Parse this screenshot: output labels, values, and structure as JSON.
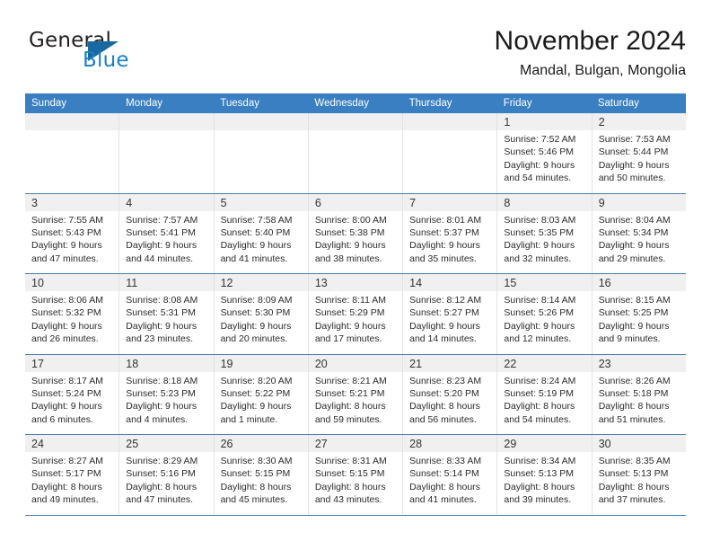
{
  "brand": {
    "name_top": "General",
    "name_bottom": "Blue",
    "triangle_icon": "triangle-icon",
    "color_dark": "#231f20",
    "color_blue": "#1c7fc4"
  },
  "header": {
    "title": "November 2024",
    "subtitle": "Mandal, Bulgan, Mongolia"
  },
  "theme": {
    "header_bar": "#3a7fc1",
    "row_rule": "#4b7fae",
    "daynum_band": "#f0f0f0",
    "cell_divider": "#e2e2e2"
  },
  "weekdays": [
    "Sunday",
    "Monday",
    "Tuesday",
    "Wednesday",
    "Thursday",
    "Friday",
    "Saturday"
  ],
  "weeks": [
    [
      {
        "day": "",
        "empty": true
      },
      {
        "day": "",
        "empty": true
      },
      {
        "day": "",
        "empty": true
      },
      {
        "day": "",
        "empty": true
      },
      {
        "day": "",
        "empty": true
      },
      {
        "day": "1",
        "sunrise": "Sunrise: 7:52 AM",
        "sunset": "Sunset: 5:46 PM",
        "daylight1": "Daylight: 9 hours",
        "daylight2": "and 54 minutes."
      },
      {
        "day": "2",
        "sunrise": "Sunrise: 7:53 AM",
        "sunset": "Sunset: 5:44 PM",
        "daylight1": "Daylight: 9 hours",
        "daylight2": "and 50 minutes."
      }
    ],
    [
      {
        "day": "3",
        "sunrise": "Sunrise: 7:55 AM",
        "sunset": "Sunset: 5:43 PM",
        "daylight1": "Daylight: 9 hours",
        "daylight2": "and 47 minutes."
      },
      {
        "day": "4",
        "sunrise": "Sunrise: 7:57 AM",
        "sunset": "Sunset: 5:41 PM",
        "daylight1": "Daylight: 9 hours",
        "daylight2": "and 44 minutes."
      },
      {
        "day": "5",
        "sunrise": "Sunrise: 7:58 AM",
        "sunset": "Sunset: 5:40 PM",
        "daylight1": "Daylight: 9 hours",
        "daylight2": "and 41 minutes."
      },
      {
        "day": "6",
        "sunrise": "Sunrise: 8:00 AM",
        "sunset": "Sunset: 5:38 PM",
        "daylight1": "Daylight: 9 hours",
        "daylight2": "and 38 minutes."
      },
      {
        "day": "7",
        "sunrise": "Sunrise: 8:01 AM",
        "sunset": "Sunset: 5:37 PM",
        "daylight1": "Daylight: 9 hours",
        "daylight2": "and 35 minutes."
      },
      {
        "day": "8",
        "sunrise": "Sunrise: 8:03 AM",
        "sunset": "Sunset: 5:35 PM",
        "daylight1": "Daylight: 9 hours",
        "daylight2": "and 32 minutes."
      },
      {
        "day": "9",
        "sunrise": "Sunrise: 8:04 AM",
        "sunset": "Sunset: 5:34 PM",
        "daylight1": "Daylight: 9 hours",
        "daylight2": "and 29 minutes."
      }
    ],
    [
      {
        "day": "10",
        "sunrise": "Sunrise: 8:06 AM",
        "sunset": "Sunset: 5:32 PM",
        "daylight1": "Daylight: 9 hours",
        "daylight2": "and 26 minutes."
      },
      {
        "day": "11",
        "sunrise": "Sunrise: 8:08 AM",
        "sunset": "Sunset: 5:31 PM",
        "daylight1": "Daylight: 9 hours",
        "daylight2": "and 23 minutes."
      },
      {
        "day": "12",
        "sunrise": "Sunrise: 8:09 AM",
        "sunset": "Sunset: 5:30 PM",
        "daylight1": "Daylight: 9 hours",
        "daylight2": "and 20 minutes."
      },
      {
        "day": "13",
        "sunrise": "Sunrise: 8:11 AM",
        "sunset": "Sunset: 5:29 PM",
        "daylight1": "Daylight: 9 hours",
        "daylight2": "and 17 minutes."
      },
      {
        "day": "14",
        "sunrise": "Sunrise: 8:12 AM",
        "sunset": "Sunset: 5:27 PM",
        "daylight1": "Daylight: 9 hours",
        "daylight2": "and 14 minutes."
      },
      {
        "day": "15",
        "sunrise": "Sunrise: 8:14 AM",
        "sunset": "Sunset: 5:26 PM",
        "daylight1": "Daylight: 9 hours",
        "daylight2": "and 12 minutes."
      },
      {
        "day": "16",
        "sunrise": "Sunrise: 8:15 AM",
        "sunset": "Sunset: 5:25 PM",
        "daylight1": "Daylight: 9 hours",
        "daylight2": "and 9 minutes."
      }
    ],
    [
      {
        "day": "17",
        "sunrise": "Sunrise: 8:17 AM",
        "sunset": "Sunset: 5:24 PM",
        "daylight1": "Daylight: 9 hours",
        "daylight2": "and 6 minutes."
      },
      {
        "day": "18",
        "sunrise": "Sunrise: 8:18 AM",
        "sunset": "Sunset: 5:23 PM",
        "daylight1": "Daylight: 9 hours",
        "daylight2": "and 4 minutes."
      },
      {
        "day": "19",
        "sunrise": "Sunrise: 8:20 AM",
        "sunset": "Sunset: 5:22 PM",
        "daylight1": "Daylight: 9 hours",
        "daylight2": "and 1 minute."
      },
      {
        "day": "20",
        "sunrise": "Sunrise: 8:21 AM",
        "sunset": "Sunset: 5:21 PM",
        "daylight1": "Daylight: 8 hours",
        "daylight2": "and 59 minutes."
      },
      {
        "day": "21",
        "sunrise": "Sunrise: 8:23 AM",
        "sunset": "Sunset: 5:20 PM",
        "daylight1": "Daylight: 8 hours",
        "daylight2": "and 56 minutes."
      },
      {
        "day": "22",
        "sunrise": "Sunrise: 8:24 AM",
        "sunset": "Sunset: 5:19 PM",
        "daylight1": "Daylight: 8 hours",
        "daylight2": "and 54 minutes."
      },
      {
        "day": "23",
        "sunrise": "Sunrise: 8:26 AM",
        "sunset": "Sunset: 5:18 PM",
        "daylight1": "Daylight: 8 hours",
        "daylight2": "and 51 minutes."
      }
    ],
    [
      {
        "day": "24",
        "sunrise": "Sunrise: 8:27 AM",
        "sunset": "Sunset: 5:17 PM",
        "daylight1": "Daylight: 8 hours",
        "daylight2": "and 49 minutes."
      },
      {
        "day": "25",
        "sunrise": "Sunrise: 8:29 AM",
        "sunset": "Sunset: 5:16 PM",
        "daylight1": "Daylight: 8 hours",
        "daylight2": "and 47 minutes."
      },
      {
        "day": "26",
        "sunrise": "Sunrise: 8:30 AM",
        "sunset": "Sunset: 5:15 PM",
        "daylight1": "Daylight: 8 hours",
        "daylight2": "and 45 minutes."
      },
      {
        "day": "27",
        "sunrise": "Sunrise: 8:31 AM",
        "sunset": "Sunset: 5:15 PM",
        "daylight1": "Daylight: 8 hours",
        "daylight2": "and 43 minutes."
      },
      {
        "day": "28",
        "sunrise": "Sunrise: 8:33 AM",
        "sunset": "Sunset: 5:14 PM",
        "daylight1": "Daylight: 8 hours",
        "daylight2": "and 41 minutes."
      },
      {
        "day": "29",
        "sunrise": "Sunrise: 8:34 AM",
        "sunset": "Sunset: 5:13 PM",
        "daylight1": "Daylight: 8 hours",
        "daylight2": "and 39 minutes."
      },
      {
        "day": "30",
        "sunrise": "Sunrise: 8:35 AM",
        "sunset": "Sunset: 5:13 PM",
        "daylight1": "Daylight: 8 hours",
        "daylight2": "and 37 minutes."
      }
    ]
  ]
}
